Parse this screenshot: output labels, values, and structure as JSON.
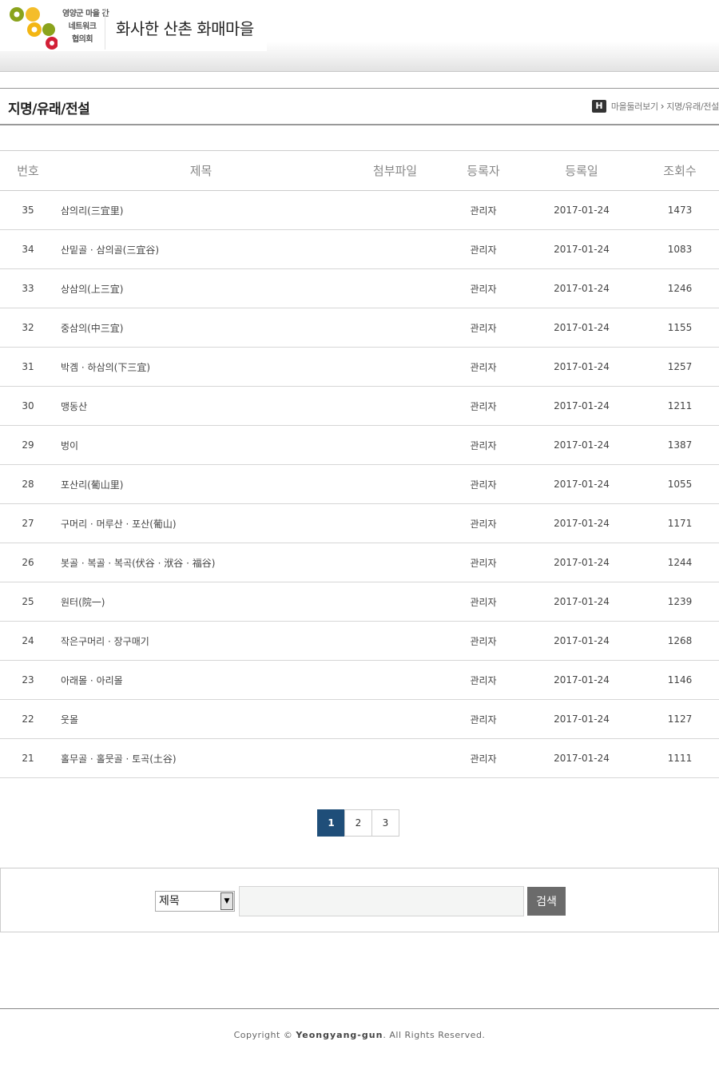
{
  "header": {
    "logo_lines": [
      "영양군 마을 간",
      "네트워크",
      "협의회"
    ],
    "logo_colors": {
      "olive": "#8aa31c",
      "yellow": "#f3b613",
      "red": "#d21f36"
    },
    "site_title": "화사한 산촌 화매마을"
  },
  "page": {
    "title": "지명/유래/전설",
    "breadcrumb": {
      "home_icon_label": "H",
      "items": [
        "마을둘러보기",
        "지명/유래/전설"
      ]
    }
  },
  "board": {
    "columns": [
      "번호",
      "제목",
      "첨부파일",
      "등록자",
      "등록일",
      "조회수"
    ],
    "rows": [
      {
        "no": "35",
        "subject": "삼의리(三宜里)",
        "attachment": "",
        "author": "관리자",
        "date": "2017-01-24",
        "views": "1473"
      },
      {
        "no": "34",
        "subject": "산밑골 · 삼의골(三宜谷)",
        "attachment": "",
        "author": "관리자",
        "date": "2017-01-24",
        "views": "1083"
      },
      {
        "no": "33",
        "subject": "상삼의(上三宜)",
        "attachment": "",
        "author": "관리자",
        "date": "2017-01-24",
        "views": "1246"
      },
      {
        "no": "32",
        "subject": "중삼의(中三宜)",
        "attachment": "",
        "author": "관리자",
        "date": "2017-01-24",
        "views": "1155"
      },
      {
        "no": "31",
        "subject": "박곔 · 하삼의(下三宜)",
        "attachment": "",
        "author": "관리자",
        "date": "2017-01-24",
        "views": "1257"
      },
      {
        "no": "30",
        "subject": "맹동산",
        "attachment": "",
        "author": "관리자",
        "date": "2017-01-24",
        "views": "1211"
      },
      {
        "no": "29",
        "subject": "벙이",
        "attachment": "",
        "author": "관리자",
        "date": "2017-01-24",
        "views": "1387"
      },
      {
        "no": "28",
        "subject": "포산리(葡山里)",
        "attachment": "",
        "author": "관리자",
        "date": "2017-01-24",
        "views": "1055"
      },
      {
        "no": "27",
        "subject": "구머리 · 머루산 · 포산(葡山)",
        "attachment": "",
        "author": "관리자",
        "date": "2017-01-24",
        "views": "1171"
      },
      {
        "no": "26",
        "subject": "봇골 · 복골 · 복곡(伏谷 · 洑谷 · 福谷)",
        "attachment": "",
        "author": "관리자",
        "date": "2017-01-24",
        "views": "1244"
      },
      {
        "no": "25",
        "subject": "원터(院一)",
        "attachment": "",
        "author": "관리자",
        "date": "2017-01-24",
        "views": "1239"
      },
      {
        "no": "24",
        "subject": "작은구머리 · 장구매기",
        "attachment": "",
        "author": "관리자",
        "date": "2017-01-24",
        "views": "1268"
      },
      {
        "no": "23",
        "subject": "아래몰 · 아리몰",
        "attachment": "",
        "author": "관리자",
        "date": "2017-01-24",
        "views": "1146"
      },
      {
        "no": "22",
        "subject": "웃몰",
        "attachment": "",
        "author": "관리자",
        "date": "2017-01-24",
        "views": "1127"
      },
      {
        "no": "21",
        "subject": "홀무골 · 홀뭇골 · 토곡(土谷)",
        "attachment": "",
        "author": "관리자",
        "date": "2017-01-24",
        "views": "1111"
      }
    ]
  },
  "pagination": {
    "pages": [
      "1",
      "2",
      "3"
    ],
    "current": "1",
    "active_color": "#1f4e79"
  },
  "search": {
    "field_selected": "제목",
    "select_arrow": "▼",
    "query_value": "",
    "button_label": "검색"
  },
  "footer": {
    "prefix": "Copyright ",
    "copyright_symbol": "©",
    "brand": "Yeongyang-gun",
    "suffix": ". All Rights Reserved."
  }
}
